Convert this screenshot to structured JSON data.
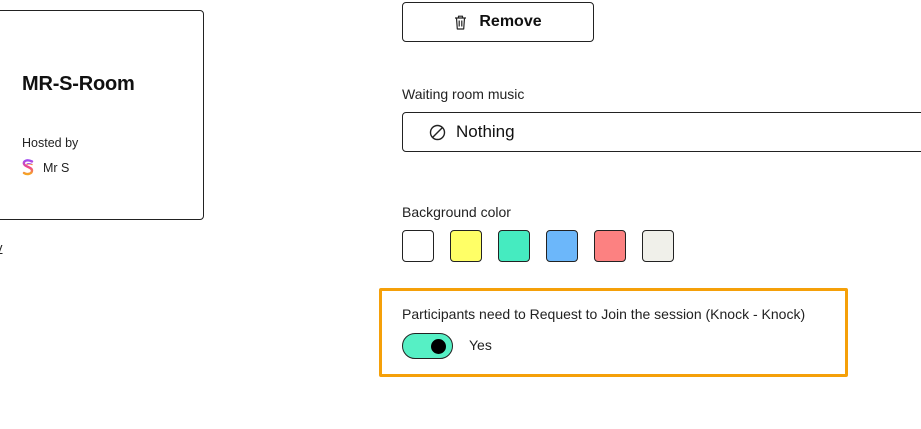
{
  "room_card": {
    "title": "MR-S-Room",
    "hosted_by_label": "Hosted by",
    "host_name": "Mr S"
  },
  "left_link": {
    "text": "v"
  },
  "remove_button": {
    "label": "Remove",
    "icon": "trash-icon"
  },
  "waiting_music": {
    "label": "Waiting room music",
    "value": "Nothing",
    "icon": "none-icon"
  },
  "background_color": {
    "label": "Background color",
    "swatches": [
      "#ffffff",
      "#ffff66",
      "#45ebc0",
      "#6cb7fa",
      "#fc8181",
      "#f0f0ea"
    ]
  },
  "knock": {
    "label": "Participants need to Request to Join the session (Knock - Knock)",
    "toggle_on": true,
    "toggle_text": "Yes",
    "highlight_color": "#f5a009"
  }
}
